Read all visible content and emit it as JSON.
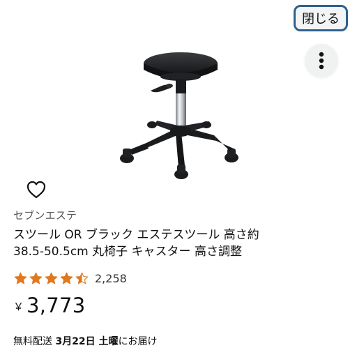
{
  "header": {
    "close_label": "閉じる"
  },
  "product": {
    "brand": "セブンエステ",
    "title_line1": "スツール OR ブラック エステスツール 高さ約",
    "title_line2": "38.5-50.5cm 丸椅子 キャスター 高さ調整",
    "rating": 4.5,
    "review_count": "2,258",
    "currency_symbol": "￥",
    "price": "3,773",
    "delivery_prefix": "無料配送 ",
    "delivery_date": "3月22日 土曜",
    "delivery_suffix": "にお届け"
  },
  "icons": {
    "more": "vertical-ellipsis-icon",
    "favorite": "heart-outline-icon",
    "stars": "star-icon"
  },
  "colors": {
    "close_border": "#2f5f8f",
    "star": "#de7921",
    "text": "#0f1111",
    "muted": "#565959"
  }
}
